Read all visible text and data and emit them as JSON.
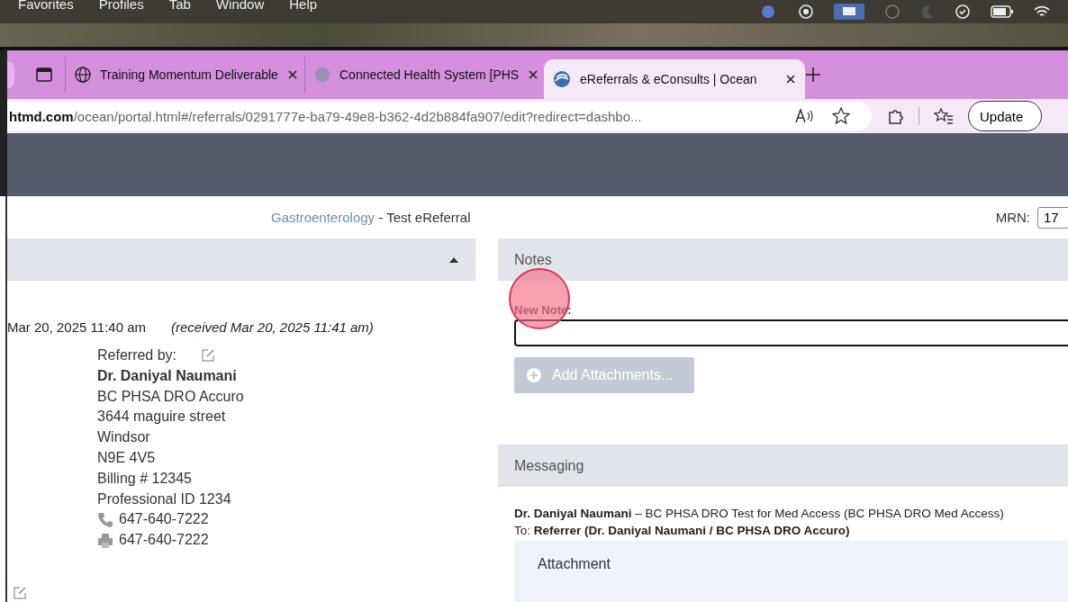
{
  "menu_bar": {
    "items": [
      "Favorites",
      "Profiles",
      "Tab",
      "Window",
      "Help"
    ]
  },
  "browser": {
    "tabs": [
      {
        "title": "Training Momentum Deliverable",
        "selected": false,
        "kind": "globe"
      },
      {
        "title": "Connected Health System [PHS",
        "selected": false,
        "kind": "site"
      },
      {
        "title": "eReferrals & eConsults | Ocean",
        "selected": true,
        "kind": "ocean"
      }
    ],
    "address": {
      "domain": "htmd.com",
      "path": "/ocean/portal.html#/referrals/0291777e-ba79-49e8-b362-4d2b884fa907/edit?redirect=dashbo..."
    },
    "update_button": "Update"
  },
  "title_bar": {
    "specialty": "Gastroenterology",
    "title": " - Test eReferral",
    "mrn_label": "MRN:",
    "mrn_value": "17"
  },
  "left_panel": {
    "expanded": true,
    "sent": "Mar 20, 2025 11:40 am",
    "received": "(received Mar 20, 2025 11:41 am)",
    "referred_by_label": "Referred by:",
    "referrer": {
      "name": "Dr. Daniyal Naumani",
      "lines": [
        "BC PHSA DRO Accuro",
        "3644 maguire street",
        "Windsor",
        "N9E 4V5",
        "Billing # 12345",
        "Professional ID 1234"
      ],
      "phone": "647-640-7222",
      "fax": "647-640-7222"
    }
  },
  "notes": {
    "title": "Notes",
    "new_note_label": "New Note:",
    "add_button": {
      "label": "Add Attachments...",
      "disabled": true
    }
  },
  "messaging": {
    "title": "Messaging",
    "sender": "Dr. Daniyal Naumani",
    "sender_org": " – BC PHSA DRO Test for Med Access (BC PHSA DRO Med Access)",
    "to_label": "To: ",
    "to": "Referrer (Dr. Daniyal Naumani / BC PHSA DRO Accuro)",
    "attachment_title": "Attachment"
  }
}
